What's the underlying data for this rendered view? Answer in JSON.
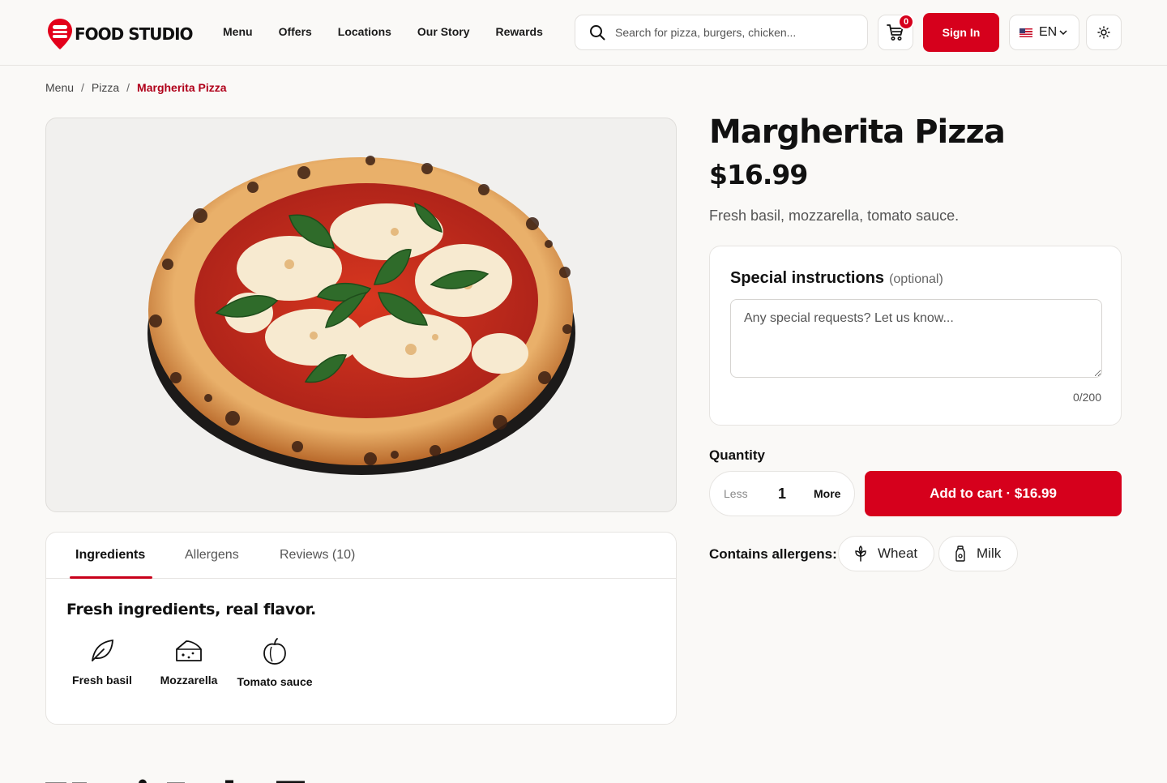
{
  "header": {
    "brand": "FOOD STUDIO",
    "nav": [
      "Menu",
      "Offers",
      "Locations",
      "Our Story",
      "Rewards"
    ],
    "search_placeholder": "Search for pizza, burgers, chicken...",
    "cart_count": "0",
    "signin_label": "Sign In",
    "language": "EN"
  },
  "breadcrumb": {
    "items": [
      "Menu",
      "Pizza"
    ],
    "current": "Margherita Pizza"
  },
  "product": {
    "title": "Margherita Pizza",
    "price": "$16.99",
    "description": "Fresh basil, mozzarella, tomato sauce."
  },
  "tabs": [
    "Ingredients",
    "Allergens",
    "Reviews (10)"
  ],
  "ingredients": {
    "heading": "Fresh ingredients, real flavor.",
    "items": [
      {
        "label": "Fresh basil",
        "icon": "leaf-icon"
      },
      {
        "label": "Mozzarella",
        "icon": "cheese-icon"
      },
      {
        "label": "Tomato sauce",
        "icon": "tomato-icon"
      }
    ]
  },
  "instructions": {
    "title": "Special instructions",
    "optional": "(optional)",
    "placeholder": "Any special requests? Let us know...",
    "counter": "0/200"
  },
  "quantity": {
    "label": "Quantity",
    "less": "Less",
    "value": "1",
    "more": "More"
  },
  "add_to_cart": "Add to cart · $16.99",
  "allergens": {
    "label": "Contains allergens:",
    "items": [
      {
        "label": "Wheat",
        "icon": "wheat-icon"
      },
      {
        "label": "Milk",
        "icon": "milk-bottle-icon"
      }
    ]
  },
  "colors": {
    "accent": "#d6001c",
    "breadcrumb_current": "#b0001a",
    "page_bg": "#faf9f7"
  }
}
